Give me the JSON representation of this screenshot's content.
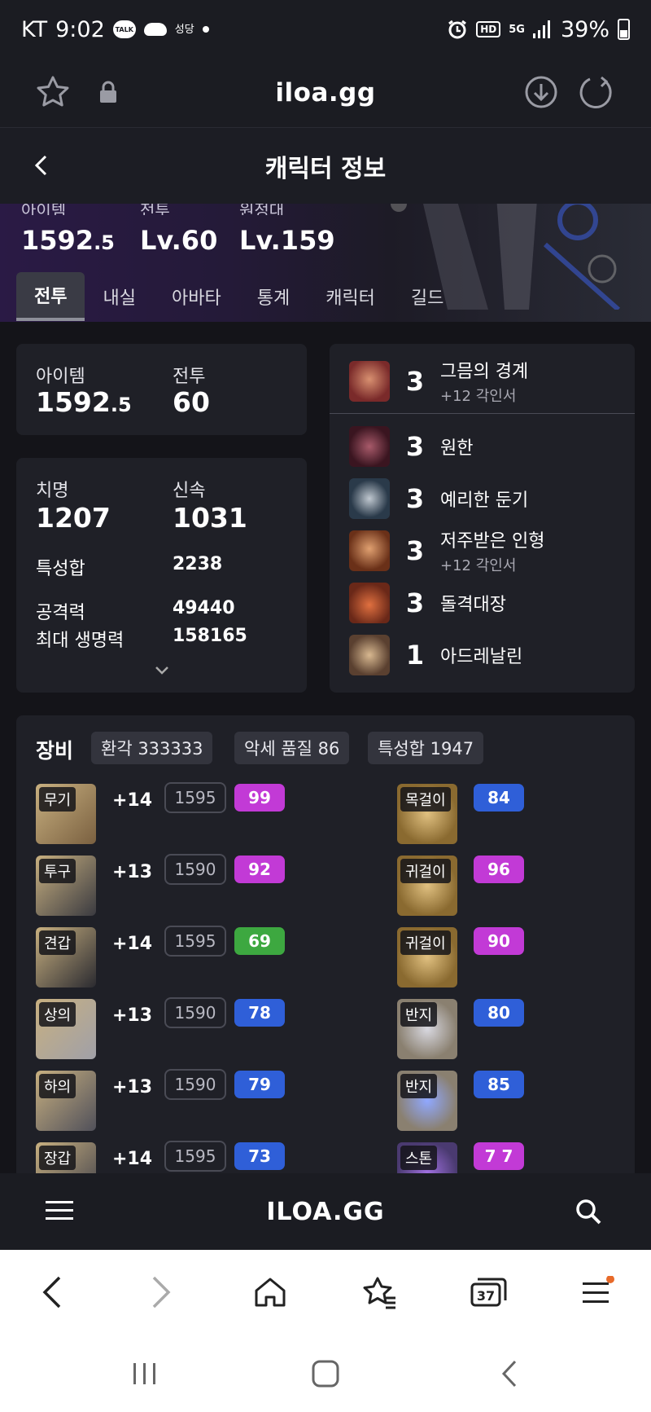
{
  "status_bar": {
    "carrier": "KT",
    "time": "9:02",
    "talk_badge": "TALK",
    "app_badge": "성당",
    "right_icons": [
      "alarm-icon",
      "hd-icon",
      "5g-icon",
      "signal-icon"
    ],
    "hd": "HD",
    "network": "5G",
    "battery": "39%"
  },
  "browser": {
    "url": "iloa.gg"
  },
  "header": {
    "title": "캐릭터 정보"
  },
  "hero": {
    "stats": [
      {
        "label": "아이템",
        "value_main": "1592",
        "value_dec": ".5"
      },
      {
        "label": "전투",
        "value_main": "Lv.60",
        "value_dec": ""
      },
      {
        "label": "원정대",
        "value_main": "Lv.159",
        "value_dec": ""
      }
    ]
  },
  "tabs": [
    "전투",
    "내실",
    "아바타",
    "통계",
    "캐릭터",
    "길드"
  ],
  "summary": {
    "item_label": "아이템",
    "item_value_main": "1592",
    "item_value_dec": ".5",
    "combat_label": "전투",
    "combat_value": "60"
  },
  "stats": {
    "crit_label": "치명",
    "crit_value": "1207",
    "swift_label": "신속",
    "swift_value": "1031",
    "trait_sum_label": "특성합",
    "trait_sum_value": "2238",
    "attack_label": "공격력",
    "attack_value": "49440",
    "hp_label": "최대 생명력",
    "hp_value": "158165"
  },
  "engravings": [
    {
      "level": "3",
      "name": "그믐의 경계",
      "sub": "+12 각인서",
      "color": "#7a2a2a"
    },
    {
      "level": "3",
      "name": "원한",
      "sub": "",
      "color": "#5a2030"
    },
    {
      "level": "3",
      "name": "예리한 둔기",
      "sub": "",
      "color": "#2a3a4a"
    },
    {
      "level": "3",
      "name": "저주받은 인형",
      "sub": "+12 각인서",
      "color": "#6a3018"
    },
    {
      "level": "3",
      "name": "돌격대장",
      "sub": "",
      "color": "#6a2818"
    },
    {
      "level": "1",
      "name": "아드레날린",
      "sub": "",
      "color": "#5a4030"
    }
  ],
  "equipment": {
    "title": "장비",
    "chips": [
      "환각 333333",
      "악세 품질 86",
      "특성합 1947"
    ],
    "gear": [
      {
        "slot": "무기",
        "enhance": "+14",
        "ilvl": "1595",
        "quality": "99",
        "qcolor": "#c23ad6"
      },
      {
        "slot": "투구",
        "enhance": "+13",
        "ilvl": "1590",
        "quality": "92",
        "qcolor": "#c23ad6"
      },
      {
        "slot": "견갑",
        "enhance": "+14",
        "ilvl": "1595",
        "quality": "69",
        "qcolor": "#3da840"
      },
      {
        "slot": "상의",
        "enhance": "+13",
        "ilvl": "1590",
        "quality": "78",
        "qcolor": "#2f5fd8"
      },
      {
        "slot": "하의",
        "enhance": "+13",
        "ilvl": "1590",
        "quality": "79",
        "qcolor": "#2f5fd8"
      },
      {
        "slot": "장갑",
        "enhance": "+14",
        "ilvl": "1595",
        "quality": "73",
        "qcolor": "#2f5fd8"
      }
    ],
    "accessories": [
      {
        "slot": "목걸이",
        "quality": "84",
        "qcolor": "#2f5fd8"
      },
      {
        "slot": "귀걸이",
        "quality": "96",
        "qcolor": "#c23ad6"
      },
      {
        "slot": "귀걸이",
        "quality": "90",
        "qcolor": "#c23ad6"
      },
      {
        "slot": "반지",
        "quality": "80",
        "qcolor": "#2f5fd8"
      },
      {
        "slot": "반지",
        "quality": "85",
        "qcolor": "#2f5fd8"
      },
      {
        "slot": "스톤",
        "quality": "7 7",
        "qcolor": "#c23ad6"
      }
    ]
  },
  "site_nav": {
    "logo": "ILOA.GG"
  },
  "browser_toolbar": {
    "tab_count": "37"
  }
}
